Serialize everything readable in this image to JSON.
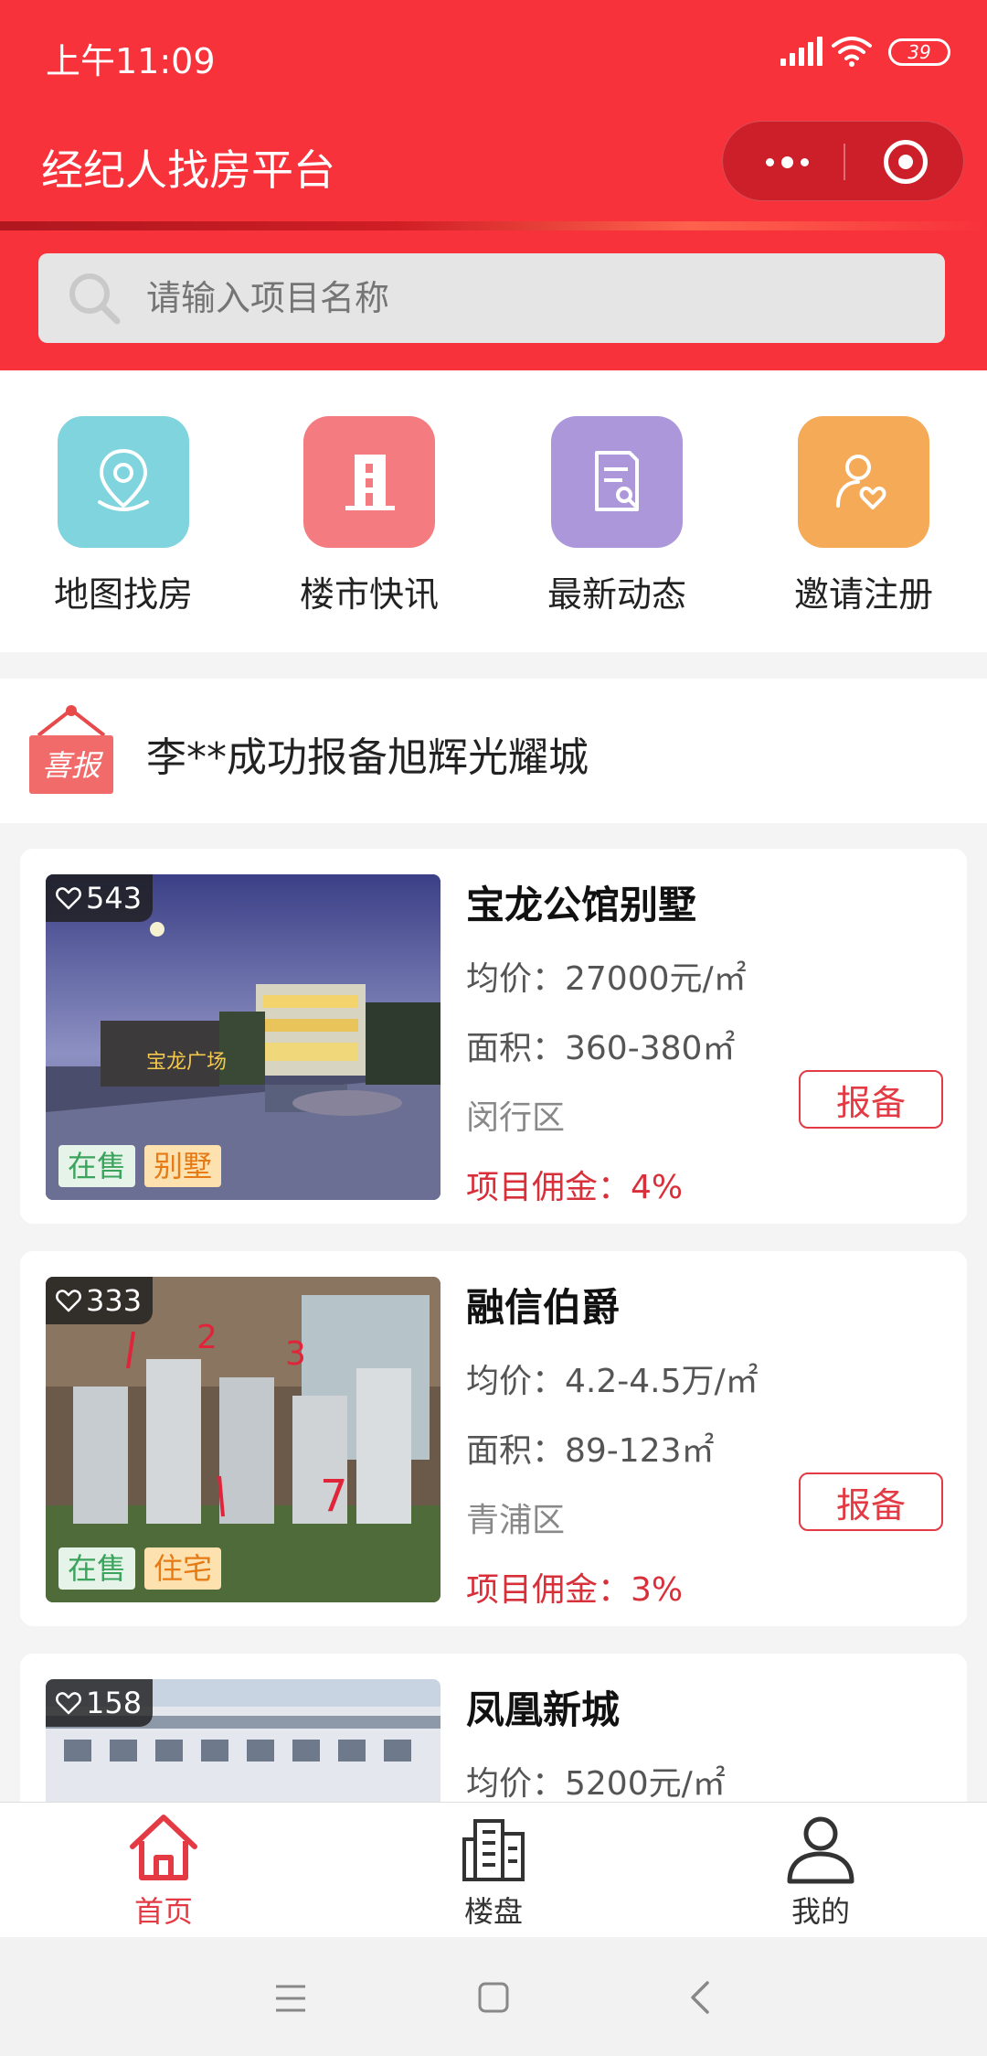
{
  "status_bar": {
    "time": "上午11:09",
    "battery": "39"
  },
  "navbar": {
    "title": "经纪人找房平台"
  },
  "search": {
    "placeholder": "请输入项目名称"
  },
  "quick_actions": [
    {
      "label": "地图找房",
      "icon": "map-pin-icon",
      "color": "#7fd4de"
    },
    {
      "label": "楼市快讯",
      "icon": "building-icon",
      "color": "#f47b7f"
    },
    {
      "label": "最新动态",
      "icon": "document-search-icon",
      "color": "#ad97db"
    },
    {
      "label": "邀请注册",
      "icon": "user-heart-icon",
      "color": "#f4aa57"
    }
  ],
  "notice": {
    "badge": "喜报",
    "text": "李**成功报备旭辉光耀城"
  },
  "listings": [
    {
      "likes": "543",
      "name": "宝龙公馆别墅",
      "price": "均价：27000元/㎡",
      "area": "面积：360-380㎡",
      "district": "闵行区",
      "commission": "项目佣金：4%",
      "tags": [
        "在售",
        "别墅"
      ],
      "report_label": "报备",
      "image_signage": "宝龙广场"
    },
    {
      "likes": "333",
      "name": "融信伯爵",
      "price": "均价：4.2-4.5万/㎡",
      "area": "面积：89-123㎡",
      "district": "青浦区",
      "commission": "项目佣金：3%",
      "tags": [
        "在售",
        "住宅"
      ],
      "report_label": "报备"
    },
    {
      "likes": "158",
      "name": "凤凰新城",
      "price": "均价：5200元/㎡"
    }
  ],
  "tabbar": [
    {
      "label": "首页",
      "active": true,
      "icon": "home-icon"
    },
    {
      "label": "楼盘",
      "active": false,
      "icon": "buildings-icon"
    },
    {
      "label": "我的",
      "active": false,
      "icon": "profile-icon"
    }
  ],
  "colors": {
    "brand": "#f7323b",
    "active_tab": "#e33a44"
  }
}
